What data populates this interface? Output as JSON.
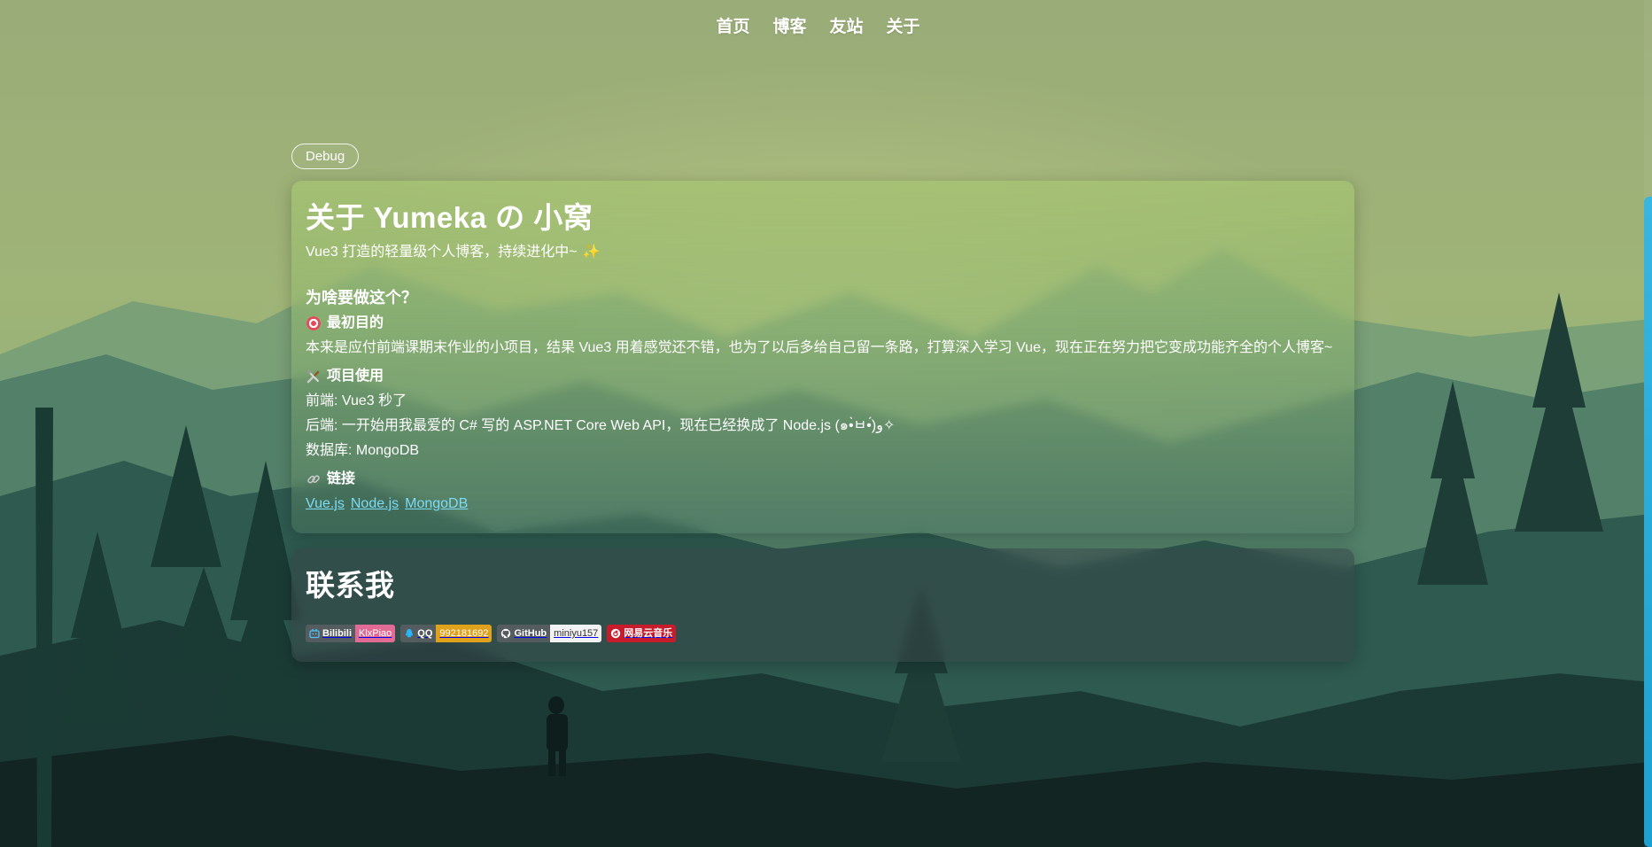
{
  "nav": [
    "首页",
    "博客",
    "友站",
    "关于"
  ],
  "debug_label": "Debug",
  "about": {
    "title": "关于 Yumeka の 小窝",
    "subtitle": "Vue3 打造的轻量级个人博客，持续进化中~",
    "subtitle_emoji": "✨",
    "section_title": "为啥要做这个？",
    "purpose": {
      "heading": "最初目的",
      "text": "本来是应付前端课期末作业的小项目，结果 Vue3 用着感觉还不错，也为了以后多给自己留一条路，打算深入学习 Vue，现在正在努力把它变成功能齐全的个人博客~"
    },
    "stack": {
      "heading": "项目使用",
      "frontend": "前端: Vue3 秒了",
      "backend": "后端: 一开始用我最爱的 C# 写的 ASP.NET Core Web API，现在已经换成了 Node.js (๑•̀ㅂ•́)و✧",
      "database": "数据库: MongoDB"
    },
    "links": {
      "heading": "链接",
      "items": [
        "Vue.js",
        "Node.js",
        "MongoDB"
      ]
    }
  },
  "contact": {
    "title": "联系我",
    "badges": [
      {
        "label": "Bilibili",
        "value": "KlxPiao",
        "icon": "bilibili-icon",
        "color": "#e26b95"
      },
      {
        "label": "QQ",
        "value": "992181692",
        "icon": "qq-icon",
        "color": "#e0a11b"
      },
      {
        "label": "GitHub",
        "value": "miniyu157",
        "icon": "github-icon",
        "color": "#f2f2f2"
      },
      {
        "label": "网易云音乐",
        "value": "",
        "icon": "netease-music-icon",
        "color": "#c71c2c"
      }
    ]
  },
  "colors": {
    "link": "#7ddcf5",
    "sky": "#9aac78",
    "scrollbar": "#1d9fd0"
  }
}
